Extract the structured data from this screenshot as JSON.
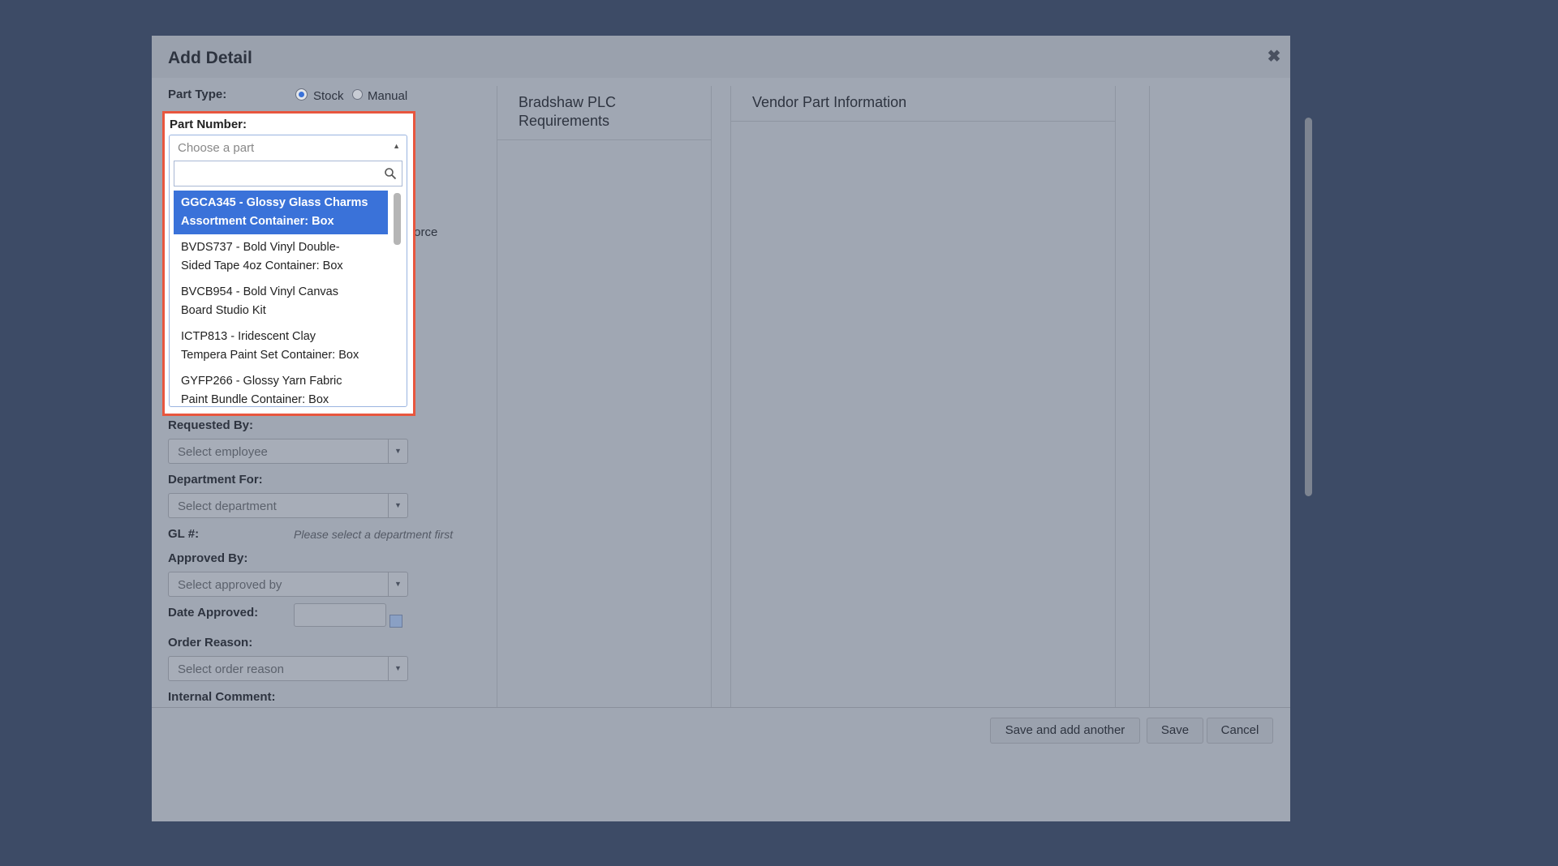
{
  "dialog": {
    "title": "Add Detail",
    "close_icon": "close-icon"
  },
  "form": {
    "part_type_label": "Part Type:",
    "part_type_options": [
      "Stock",
      "Manual"
    ],
    "part_type_selected": "Stock",
    "part_number_label": "Part Number:",
    "part_number_placeholder": "Choose a part",
    "obscured_text_fragment": "Force",
    "requested_by_label": "Requested By:",
    "requested_by_placeholder": "Select employee",
    "department_for_label": "Department For:",
    "department_for_placeholder": "Select department",
    "gl_label": "GL #:",
    "gl_helper": "Please select a department first",
    "approved_by_label": "Approved By:",
    "approved_by_placeholder": "Select approved by",
    "date_approved_label": "Date Approved:",
    "order_reason_label": "Order Reason:",
    "order_reason_placeholder": "Select order reason",
    "internal_comment_label": "Internal Comment:"
  },
  "part_dropdown": {
    "search_value": "",
    "options": [
      {
        "line1": "GGCA345 - Glossy Glass Charms",
        "line2": "Assortment Container: Box"
      },
      {
        "line1": "BVDS737 - Bold Vinyl Double-",
        "line2": "Sided Tape 4oz Container: Box"
      },
      {
        "line1": "BVCB954 - Bold Vinyl Canvas",
        "line2": "Board Studio Kit"
      },
      {
        "line1": "ICTP813 - Iridescent Clay",
        "line2": "Tempera Paint Set Container: Box"
      },
      {
        "line1": "GYFP266 - Glossy Yarn Fabric",
        "line2": "Paint Bundle Container: Box"
      }
    ],
    "selected_index": 0
  },
  "panels": {
    "requirements_title": "Bradshaw PLC Requirements",
    "vendor_title": "Vendor Part Information"
  },
  "footer": {
    "save_and_add": "Save and add another",
    "save": "Save",
    "cancel": "Cancel"
  },
  "colors": {
    "highlight_border": "#e8563e",
    "selected_option": "#3a72d9",
    "backdrop": "#3d4b66"
  }
}
